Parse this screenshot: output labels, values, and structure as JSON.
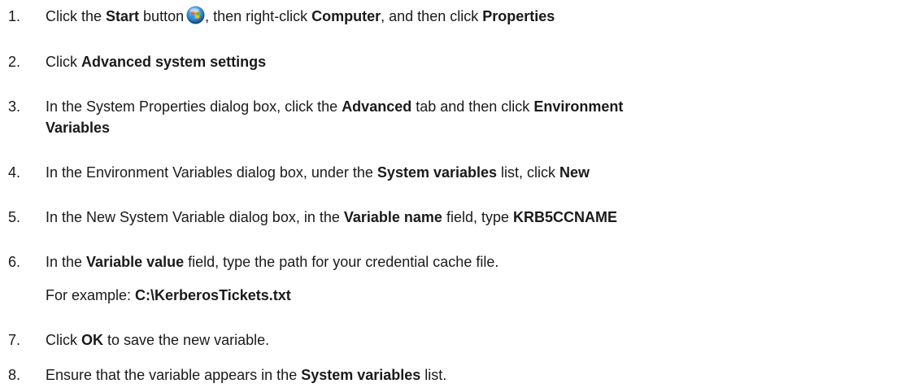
{
  "steps": [
    {
      "num": "1.",
      "parts": [
        {
          "t": "Click the "
        },
        {
          "t": "Start",
          "b": true
        },
        {
          "t": " button"
        },
        {
          "icon": "windows-start-orb-icon"
        },
        {
          "t": ", then right-click "
        },
        {
          "t": "Computer",
          "b": true
        },
        {
          "t": ", and then click "
        },
        {
          "t": "Properties",
          "b": true
        }
      ]
    },
    {
      "num": "2.",
      "parts": [
        {
          "t": "Click "
        },
        {
          "t": "Advanced system settings",
          "b": true
        }
      ]
    },
    {
      "num": "3.",
      "parts": [
        {
          "t": "In the System Properties dialog box, click the "
        },
        {
          "t": "Advanced",
          "b": true
        },
        {
          "t": " tab and then click "
        },
        {
          "t": "Environment",
          "b": true
        }
      ],
      "line2": [
        {
          "t": "Variables",
          "b": true
        }
      ]
    },
    {
      "num": "4.",
      "parts": [
        {
          "t": "In the Environment Variables dialog box, under the "
        },
        {
          "t": "System variables",
          "b": true
        },
        {
          "t": " list, click "
        },
        {
          "t": "New",
          "b": true
        }
      ]
    },
    {
      "num": "5.",
      "parts": [
        {
          "t": "In the New System Variable dialog box, in the "
        },
        {
          "t": "Variable name",
          "b": true
        },
        {
          "t": " field, type "
        },
        {
          "t": "KRB5CCNAME",
          "b": true
        }
      ]
    },
    {
      "num": "6.",
      "parts": [
        {
          "t": "In the "
        },
        {
          "t": "Variable value",
          "b": true
        },
        {
          "t": " field, type the path for your credential cache file."
        }
      ],
      "line2": [
        {
          "t": "For example: "
        },
        {
          "t": "C:\\KerberosTickets.txt",
          "b": true
        }
      ]
    },
    {
      "num": "7.",
      "parts": [
        {
          "t": "Click "
        },
        {
          "t": "OK",
          "b": true
        },
        {
          "t": " to save the new variable."
        }
      ]
    },
    {
      "num": "8.",
      "parts": [
        {
          "t": "Ensure that the variable appears in the "
        },
        {
          "t": "System variables",
          "b": true
        },
        {
          "t": " list."
        }
      ]
    }
  ]
}
